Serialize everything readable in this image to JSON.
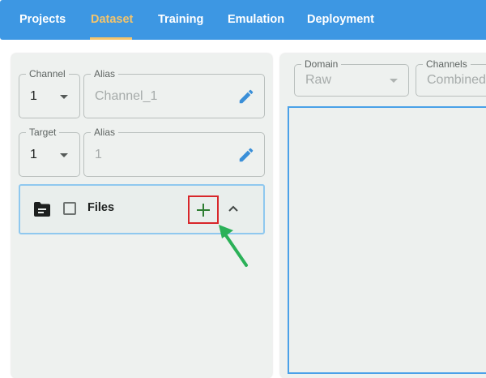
{
  "nav": {
    "tabs": [
      {
        "label": "Projects"
      },
      {
        "label": "Dataset",
        "active": true
      },
      {
        "label": "Training"
      },
      {
        "label": "Emulation"
      },
      {
        "label": "Deployment"
      }
    ]
  },
  "left_panel": {
    "channel": {
      "label": "Channel",
      "value": "1"
    },
    "channel_alias": {
      "label": "Alias",
      "value": "Channel_1"
    },
    "target": {
      "label": "Target",
      "value": "1"
    },
    "target_alias": {
      "label": "Alias",
      "value": "1"
    },
    "files": {
      "label": "Files"
    }
  },
  "right_panel": {
    "domain": {
      "label": "Domain",
      "value": "Raw"
    },
    "channels": {
      "label": "Channels",
      "value": "Combined"
    }
  },
  "icons": {
    "folder": "folder-open-icon",
    "pencil": "pencil-icon",
    "add": "plus-icon",
    "collapse": "chevron-up-icon",
    "dropdown": "caret-down-icon"
  },
  "colors": {
    "nav_bg": "#3d97e3",
    "active_tab": "#f2c46d",
    "accent_blue": "#3a8fd8",
    "add_icon": "#2e7d32",
    "highlight_box": "#d8262a",
    "annotation_arrow": "#2bb158"
  }
}
